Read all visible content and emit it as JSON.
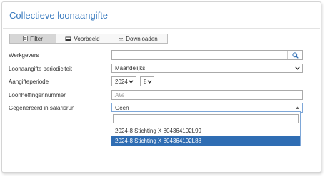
{
  "page": {
    "title": "Collectieve loonaangifte"
  },
  "tabs": [
    {
      "label": "Filter",
      "icon": "document-icon",
      "active": true
    },
    {
      "label": "Voorbeeld",
      "icon": "image-icon",
      "active": false
    },
    {
      "label": "Downloaden",
      "icon": "download-icon",
      "active": false
    }
  ],
  "form": {
    "werkgevers": {
      "label": "Werkgevers",
      "value": "",
      "icon": "search-icon"
    },
    "periodiciteit": {
      "label": "Loonaangifte periodiciteit",
      "value": "Maandelijks"
    },
    "aangifteperiode": {
      "label": "Aangifteperiode",
      "year": "2024",
      "month": "8"
    },
    "loonheffingennummer": {
      "label": "Loonheffingennummer",
      "placeholder": "Alle"
    },
    "salarisrun": {
      "label": "Gegenereerd in salarisrun",
      "value": "Geen",
      "search_value": "",
      "options": [
        {
          "label": "2024-8 Stichting X 804364102L99",
          "selected": false
        },
        {
          "label": "2024-8 Stichting X 804364102L88",
          "selected": true
        }
      ]
    }
  },
  "colors": {
    "title": "#3a7bbf",
    "selected_option_bg": "#2f6db3",
    "dropdown_border": "#7ea7d8"
  }
}
